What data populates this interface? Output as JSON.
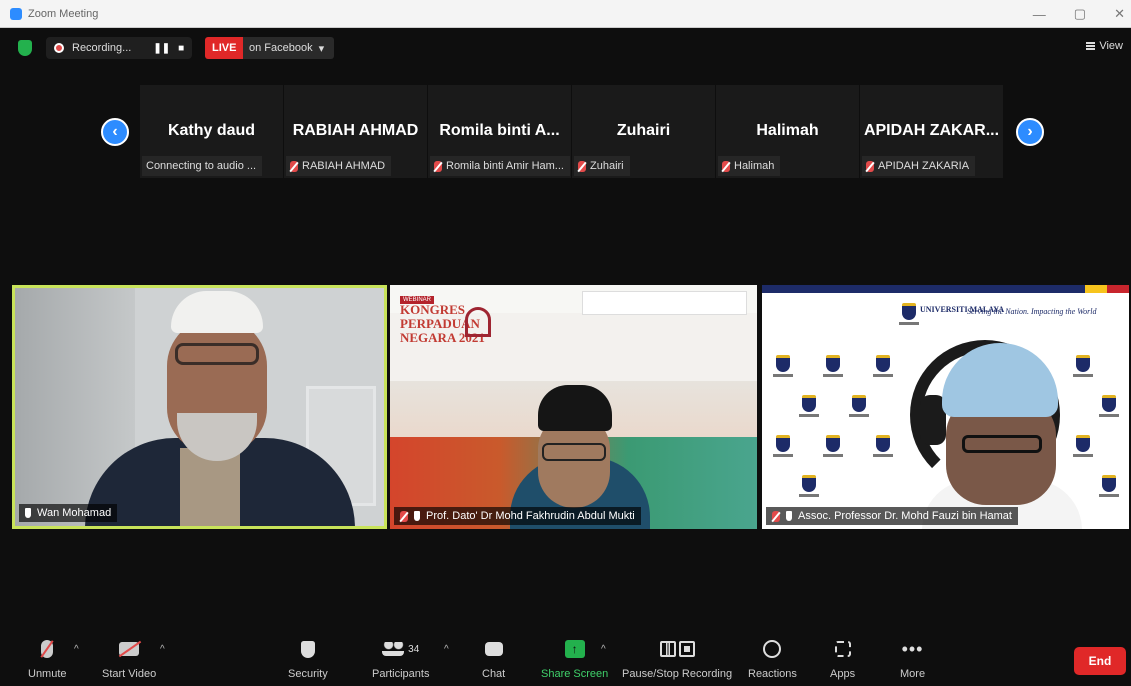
{
  "window": {
    "title": "Zoom Meeting",
    "controls": [
      "—",
      "▢",
      "✕"
    ]
  },
  "topbar": {
    "recording_label": "Recording...",
    "pause_glyph": "❚❚",
    "stop_glyph": "■",
    "live_label": "LIVE",
    "live_target": "on Facebook",
    "live_caret": "▾",
    "view_label": "View"
  },
  "strip": {
    "prev_arrow": "‹",
    "next_arrow": "›",
    "tiles": [
      {
        "name": "Kathy daud",
        "label": "Connecting to audio ...",
        "muted": false
      },
      {
        "name": "RABIAH AHMAD",
        "label": "RABIAH AHMAD",
        "muted": true
      },
      {
        "name": "Romila binti A...",
        "label": "Romila binti Amir Ham...",
        "muted": true
      },
      {
        "name": "Zuhairi",
        "label": "Zuhairi",
        "muted": true
      },
      {
        "name": "Halimah",
        "label": "Halimah",
        "muted": true
      },
      {
        "name": "APIDAH ZAKAR...",
        "label": "APIDAH ZAKARIA",
        "muted": true
      }
    ]
  },
  "videos": [
    {
      "label": "Wan Mohamad"
    },
    {
      "label": "Prof. Dato' Dr Mohd Fakhrudin Abdul Mukti",
      "background_tag": "WEBINAR",
      "background_title_1": "KONGRES",
      "background_title_2": "PERPADUAN",
      "background_title_3": "NEGARA 2021"
    },
    {
      "label": "Assoc. Professor Dr. Mohd Fauzi bin Hamat",
      "background_logo": "UNIVERSITI MALAYA",
      "background_motto": "Serving the Nation. Impacting the World"
    }
  ],
  "toolbar": {
    "unmute": "Unmute",
    "start_video": "Start Video",
    "security": "Security",
    "participants": "Participants",
    "participants_count": "34",
    "chat": "Chat",
    "share_screen": "Share Screen",
    "recording": "Pause/Stop Recording",
    "reactions": "Reactions",
    "apps": "Apps",
    "more": "More",
    "end": "End",
    "caret": "^",
    "more_glyph": "•••",
    "share_glyph": "↑"
  },
  "colors": {
    "accent": "#2d8cff",
    "live": "#e02828",
    "share": "#23b14d",
    "active_speaker": "#c8e35a"
  }
}
